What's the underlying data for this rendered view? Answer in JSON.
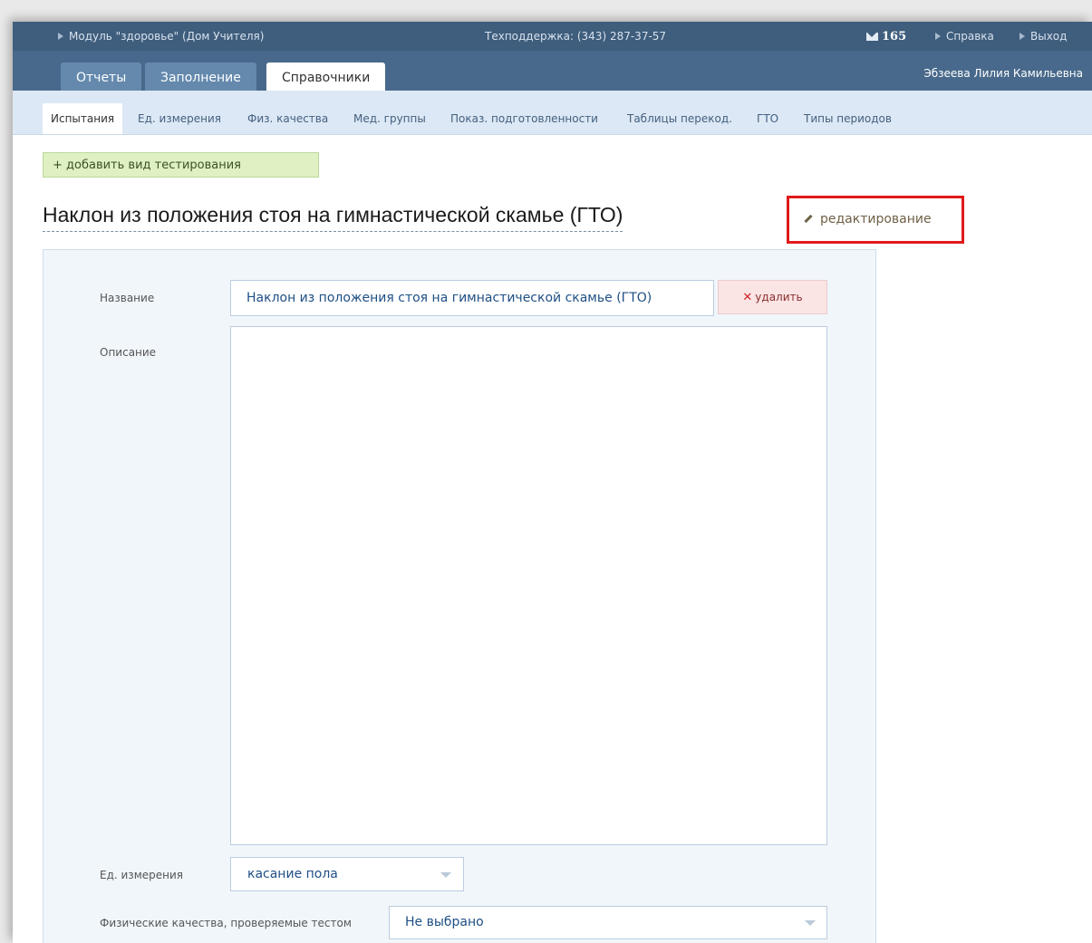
{
  "topbar": {
    "module": "Модуль \"здоровье\" (Дом Учителя)",
    "support": "Техподдержка: (343) 287-37-57",
    "messages_count": "165",
    "help": "Справка",
    "logout": "Выход"
  },
  "tabs": [
    {
      "label": "Отчеты"
    },
    {
      "label": "Заполнение"
    },
    {
      "label": "Справочники"
    }
  ],
  "user_name": "Эбзеева Лилия Камильевна",
  "subnav": [
    {
      "label": "Испытания"
    },
    {
      "label": "Ед. измерения"
    },
    {
      "label": "Физ. качества"
    },
    {
      "label": "Мед. группы"
    },
    {
      "label": "Показ. подготовленности"
    },
    {
      "label": "Таблицы перекод."
    },
    {
      "label": "ГТО"
    },
    {
      "label": "Типы периодов"
    }
  ],
  "add_button": "+ добавить вид тестирования",
  "page_title": "Наклон из положения стоя на гимнастической скамье (ГТО)",
  "edit_link": "редактирование",
  "form": {
    "name_label": "Название",
    "name_value": "Наклон из положения стоя на гимнастической скамье (ГТО)",
    "delete_label": "удалить",
    "description_label": "Описание",
    "description_value": "",
    "unit_label": "Ед. измерения",
    "unit_value": "касание пола",
    "qualities_label": "Физические качества, проверяемые тестом",
    "qualities_value": "Не выбрано"
  },
  "icons": {
    "envelope": "envelope-icon",
    "edit": "pencil-icon",
    "delete": "cross-icon",
    "dropdown": "caret-down-icon"
  },
  "colors": {
    "header_dark": "#3f5d7c",
    "tabbar": "#48698b",
    "subnav_bg": "#dce8f5",
    "highlight_box": "#e01a1a",
    "add_button_bg": "#dff0c2"
  }
}
